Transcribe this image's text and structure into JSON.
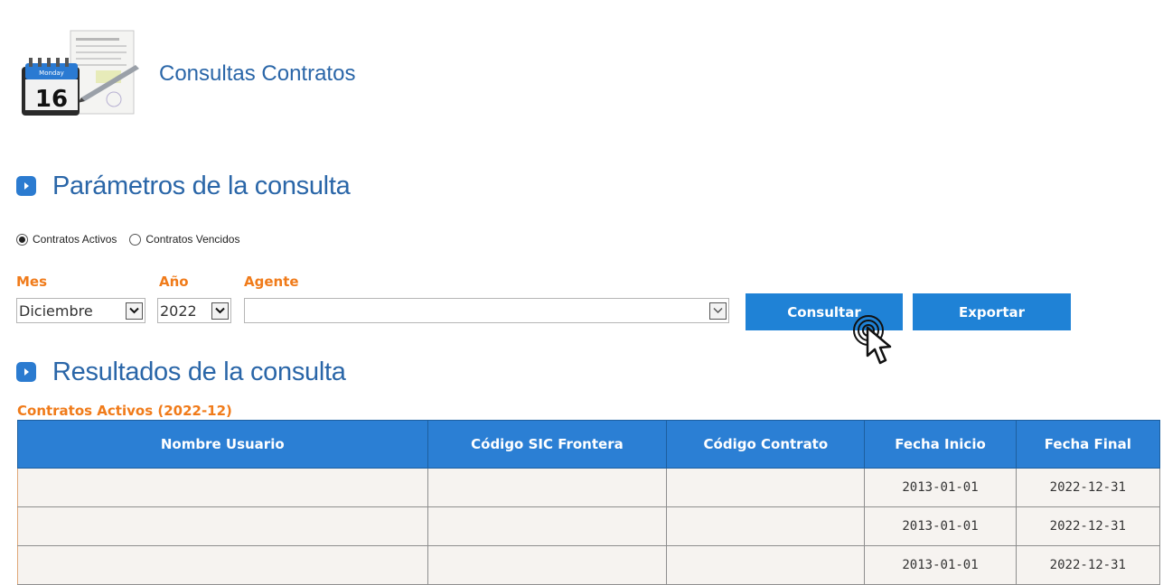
{
  "page": {
    "title": "Consultas Contratos",
    "icon": "calendar-contract-icon",
    "calendar_day_label": "Monday",
    "calendar_day_number": "16"
  },
  "params_section": {
    "title": "Parámetros de la consulta"
  },
  "contract_filter": {
    "options": [
      {
        "label": "Contratos Activos",
        "selected": true
      },
      {
        "label": "Contratos Vencidos",
        "selected": false
      }
    ]
  },
  "filters": {
    "mes": {
      "label": "Mes",
      "value": "Diciembre"
    },
    "anio": {
      "label": "Año",
      "value": "2022"
    },
    "agente": {
      "label": "Agente",
      "value": ""
    }
  },
  "buttons": {
    "consultar": "Consultar",
    "exportar": "Exportar"
  },
  "results_section": {
    "title": "Resultados de la consulta"
  },
  "results": {
    "caption": "Contratos Activos (2022-12)",
    "columns": [
      "Nombre Usuario",
      "Código SIC Frontera",
      "Código Contrato",
      "Fecha Inicio",
      "Fecha Final"
    ],
    "rows": [
      [
        "",
        "",
        "",
        "2013-01-01",
        "2022-12-31"
      ],
      [
        "",
        "",
        "",
        "2013-01-01",
        "2022-12-31"
      ],
      [
        "",
        "",
        "",
        "2013-01-01",
        "2022-12-31"
      ]
    ]
  },
  "colors": {
    "accent": "#2b7fd4",
    "title": "#2a66a8",
    "label": "#f07b1a"
  }
}
